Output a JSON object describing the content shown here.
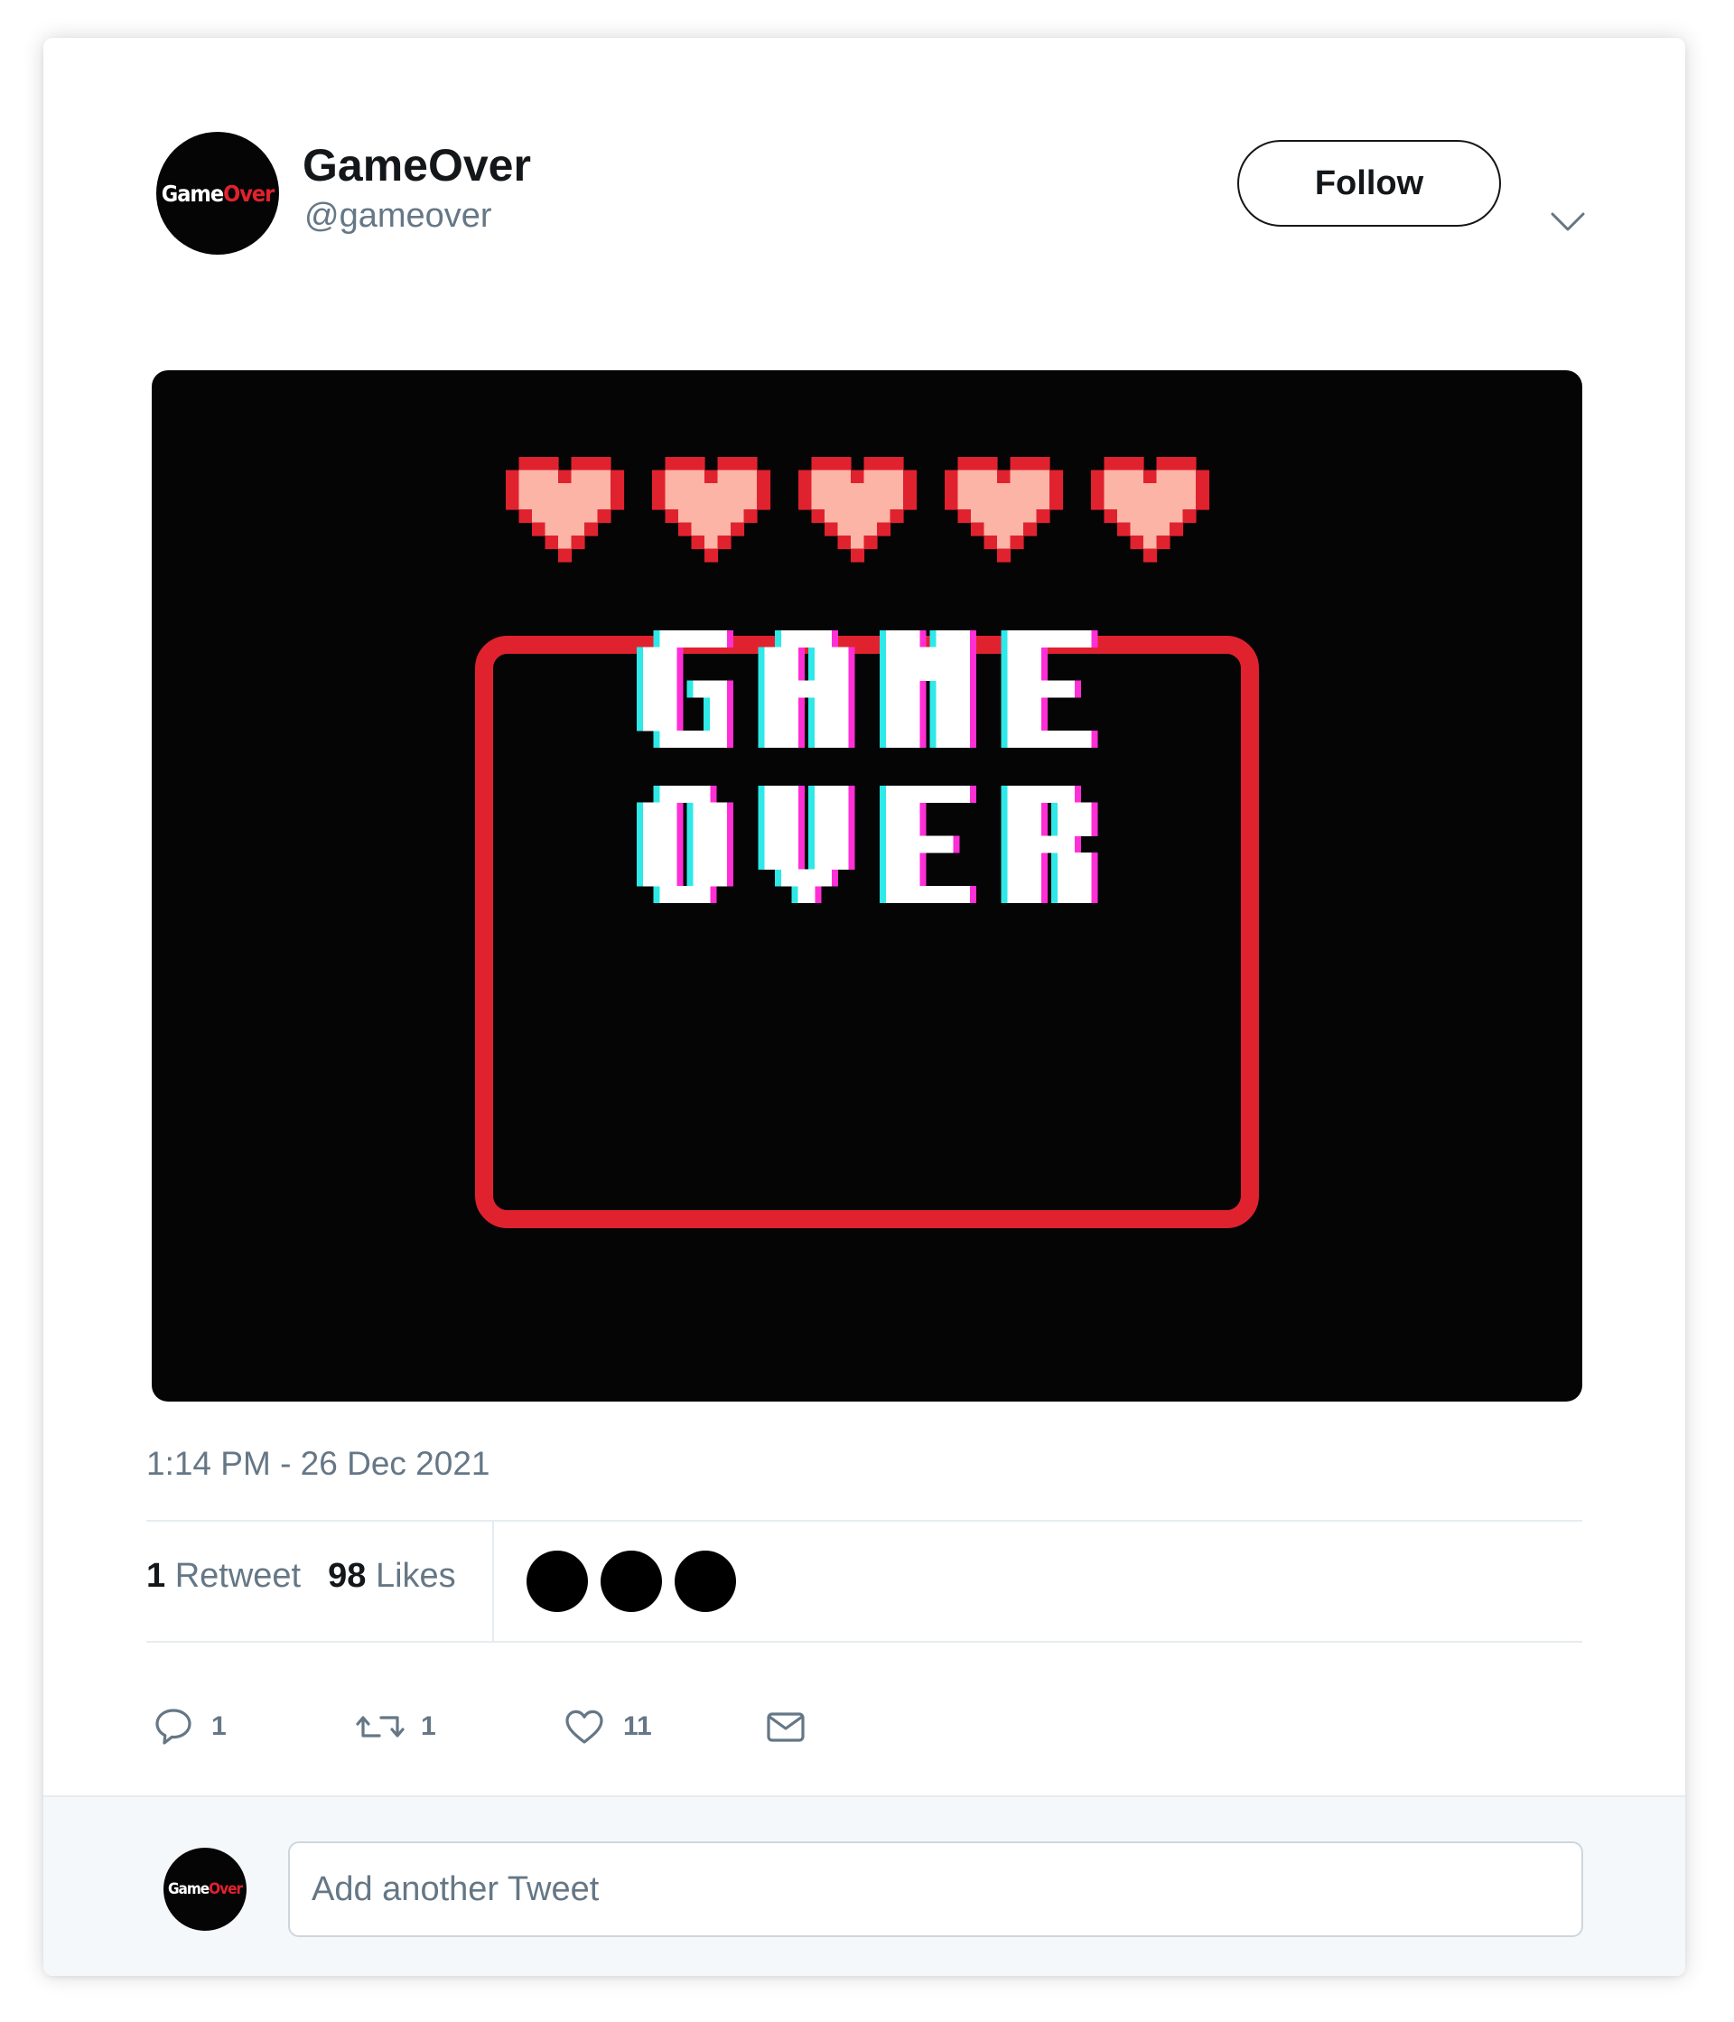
{
  "author": {
    "avatar_text_part1": "Game",
    "avatar_text_part2": "Over",
    "display_name": "GameOver",
    "handle": "@gameover"
  },
  "header": {
    "follow_label": "Follow",
    "more_icon": "chevron-down-icon"
  },
  "media": {
    "hearts_count": 5,
    "line1": "GAME",
    "line2": "OVER",
    "colors": {
      "background": "#050505",
      "heart_fill": "#fbb4a5",
      "heart_outline": "#e0222f",
      "frame": "#e0222f",
      "text": "#ffffff",
      "glitch_cyan": "#2fe8e8",
      "glitch_magenta": "#ff2fd6"
    }
  },
  "timestamp": "1:14 PM - 26 Dec 2021",
  "stats": {
    "retweet_count": "1",
    "retweet_label": "Retweet",
    "likes_count": "98",
    "likes_label": "Likes",
    "liker_avatars": 3
  },
  "actions": [
    {
      "icon": "reply-icon",
      "count": "1"
    },
    {
      "icon": "retweet-icon",
      "count": "1"
    },
    {
      "icon": "heart-icon",
      "count": "11"
    },
    {
      "icon": "mail-icon",
      "count": ""
    }
  ],
  "reply": {
    "placeholder": "Add another Tweet"
  },
  "colors": {
    "text_primary": "#14171a",
    "text_secondary": "#657786",
    "divider": "#e6ecf0",
    "footer_bg": "#f5f8fa"
  }
}
